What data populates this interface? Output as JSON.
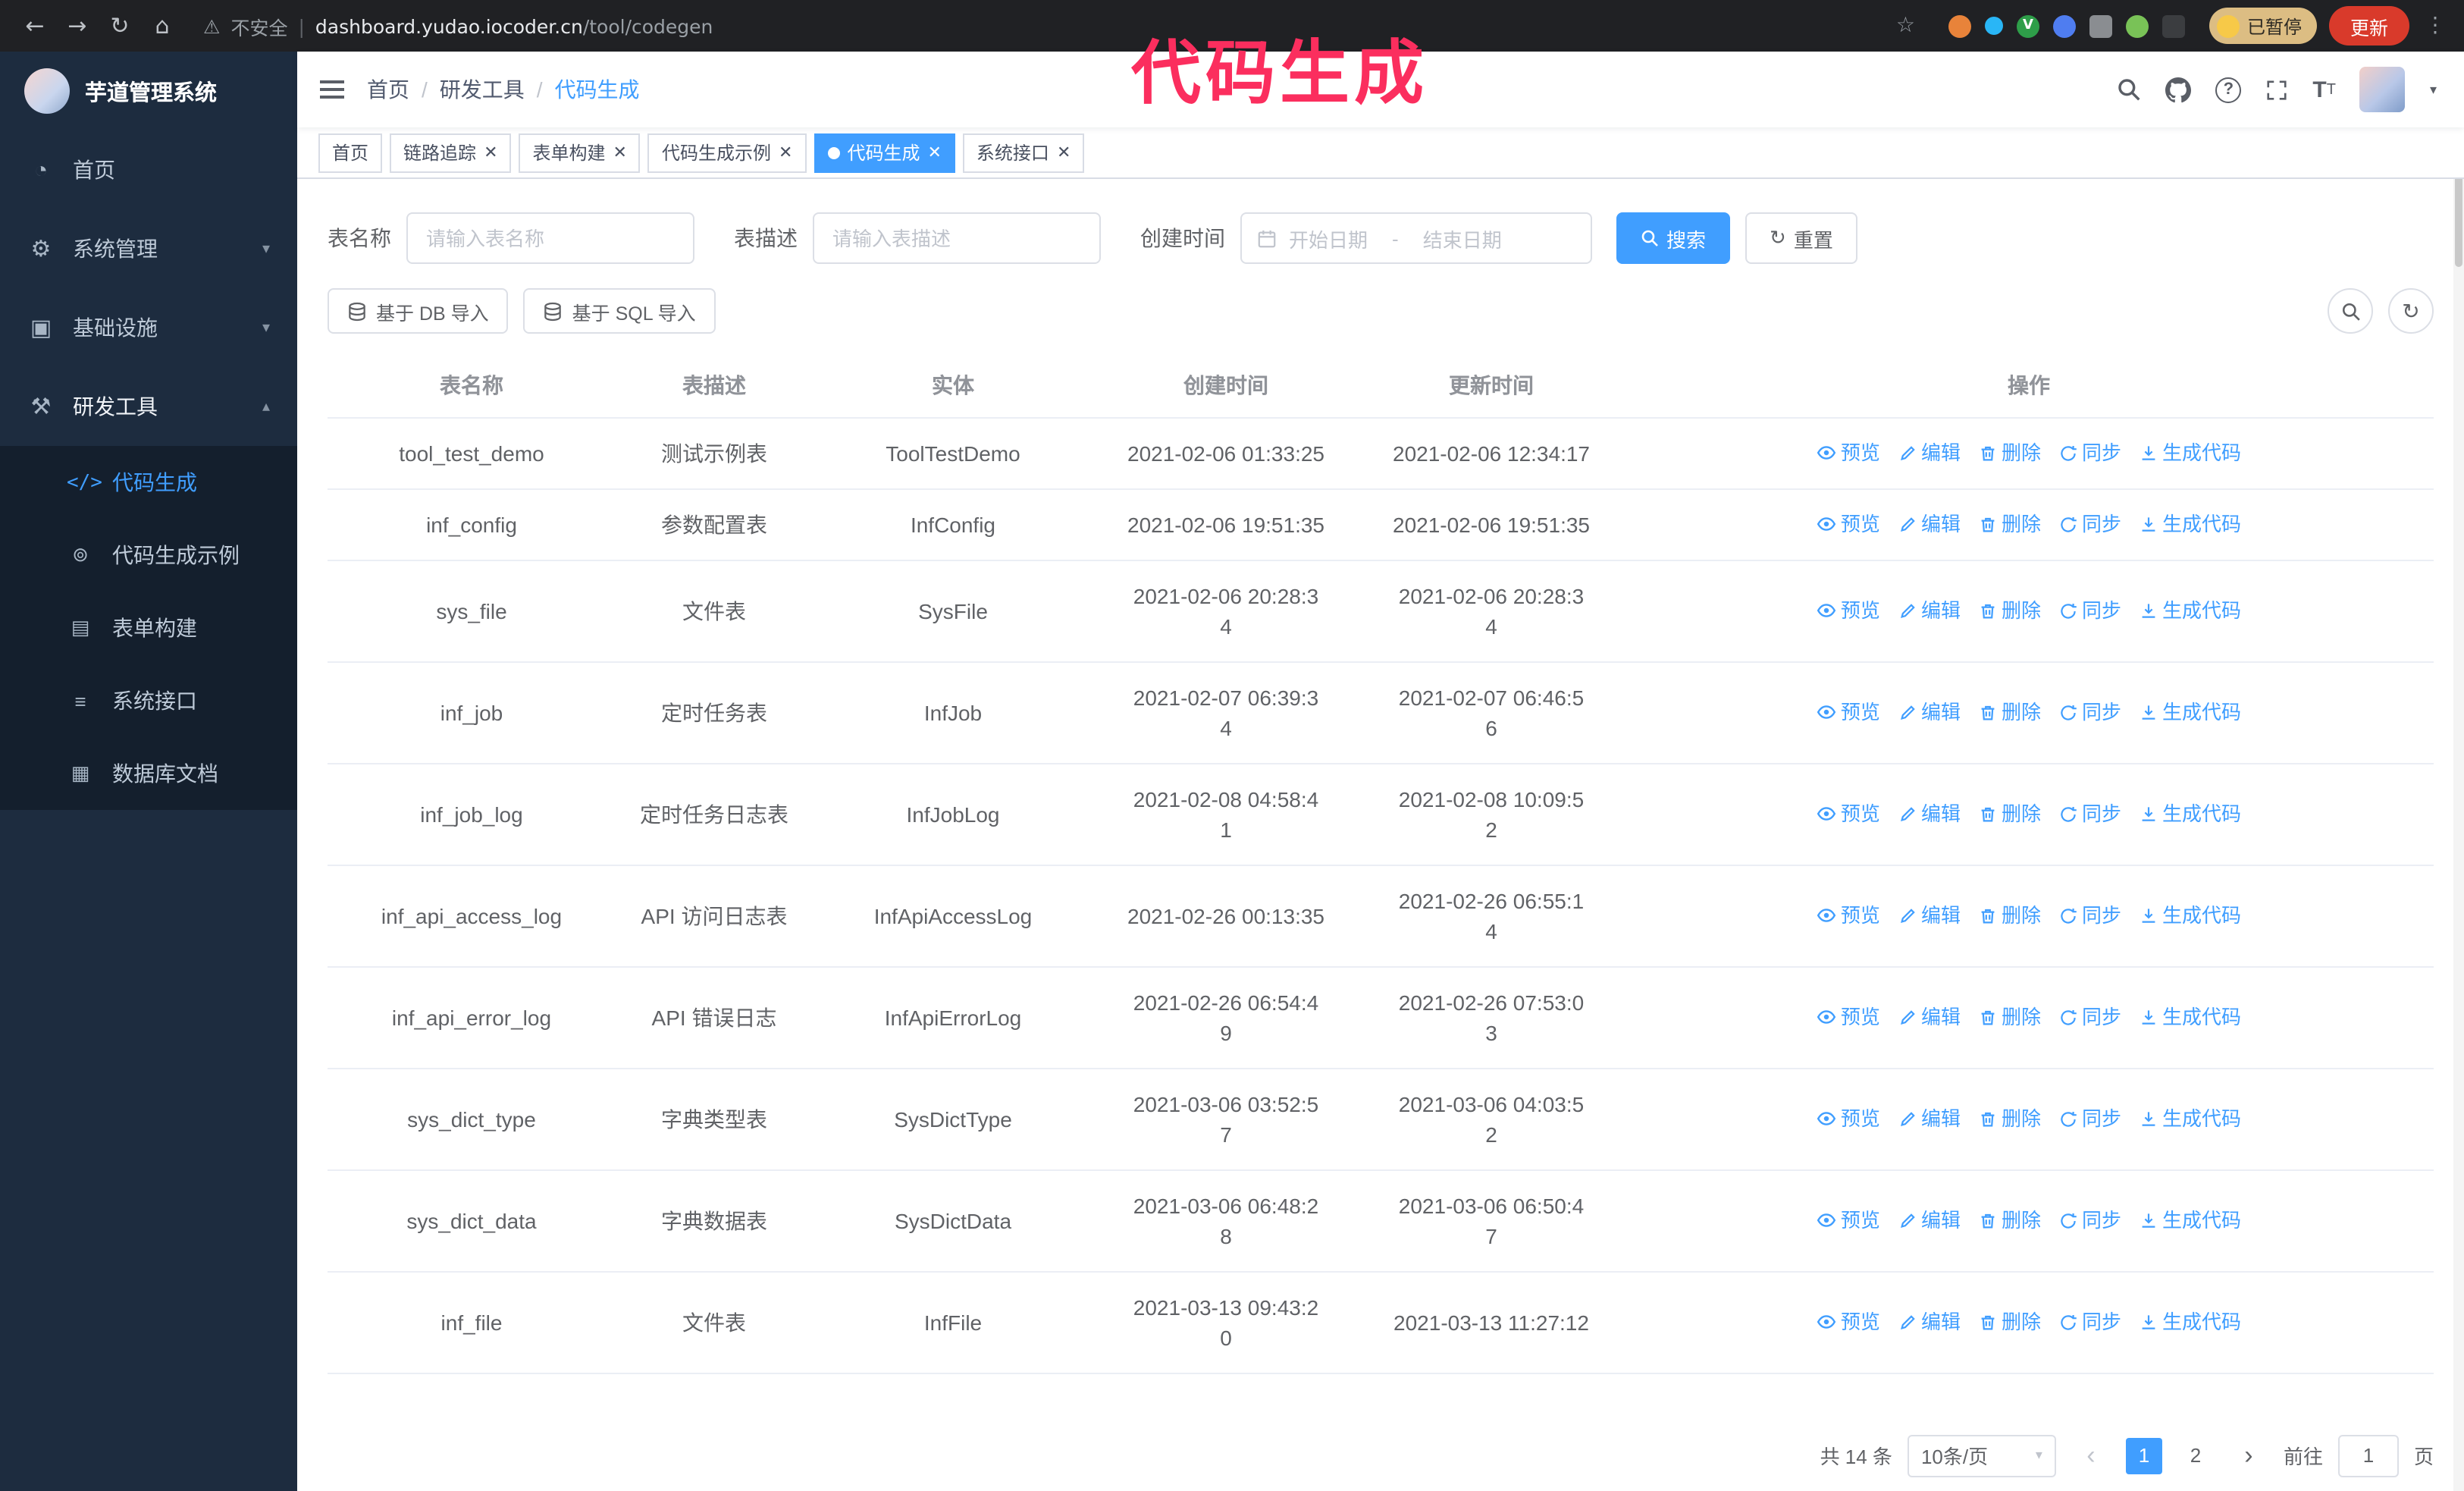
{
  "colors": {
    "accent": "#409eff",
    "sidebar_bg": "#1d2c3f",
    "sidebar_submenu_bg": "#141f2d",
    "chrome_bg": "#202124",
    "annotation": "#fb2e5e",
    "update_button_bg": "#d93a2b"
  },
  "browser": {
    "security_label": "不安全",
    "url_host": "dashboard.yudao.iocoder.cn",
    "url_path": "/tool/codegen",
    "paused_badge": "已暂停",
    "update_button": "更新"
  },
  "annotation": {
    "text": "代码生成"
  },
  "sidebar": {
    "logo_title": "芋道管理系统",
    "menu": [
      {
        "label": "首页",
        "icon": "dashboard-icon"
      },
      {
        "label": "系统管理",
        "icon": "gear-icon"
      },
      {
        "label": "基础设施",
        "icon": "infrastructure-icon"
      },
      {
        "label": "研发工具",
        "icon": "tools-icon"
      }
    ],
    "submenu": [
      {
        "label": "代码生成",
        "icon": "code-icon"
      },
      {
        "label": "代码生成示例",
        "icon": "example-icon"
      },
      {
        "label": "表单构建",
        "icon": "form-icon"
      },
      {
        "label": "系统接口",
        "icon": "api-icon"
      },
      {
        "label": "数据库文档",
        "icon": "database-icon"
      }
    ]
  },
  "navbar": {
    "breadcrumb": [
      "首页",
      "研发工具",
      "代码生成"
    ]
  },
  "tabs": [
    {
      "label": "首页"
    },
    {
      "label": "链路追踪"
    },
    {
      "label": "表单构建"
    },
    {
      "label": "代码生成示例"
    },
    {
      "label": "代码生成"
    },
    {
      "label": "系统接口"
    }
  ],
  "filters": {
    "name_label": "表名称",
    "name_placeholder": "请输入表名称",
    "desc_label": "表描述",
    "desc_placeholder": "请输入表描述",
    "time_label": "创建时间",
    "start_placeholder": "开始日期",
    "range_separator": "-",
    "end_placeholder": "结束日期",
    "search_button": "搜索",
    "reset_button": "重置"
  },
  "toolbar": {
    "import_db_button": "基于 DB 导入",
    "import_sql_button": "基于 SQL 导入"
  },
  "table": {
    "columns": [
      "表名称",
      "表描述",
      "实体",
      "创建时间",
      "更新时间",
      "操作"
    ],
    "actions": [
      {
        "label": "预览",
        "icon": "eye-icon"
      },
      {
        "label": "编辑",
        "icon": "edit-icon"
      },
      {
        "label": "删除",
        "icon": "delete-icon"
      },
      {
        "label": "同步",
        "icon": "sync-icon"
      },
      {
        "label": "生成代码",
        "icon": "download-icon"
      }
    ],
    "rows": [
      {
        "name": "tool_test_demo",
        "desc": "测试示例表",
        "entity": "ToolTestDemo",
        "created": "2021-02-06 01:33:25",
        "updated": "2021-02-06 12:34:17"
      },
      {
        "name": "inf_config",
        "desc": "参数配置表",
        "entity": "InfConfig",
        "created": "2021-02-06 19:51:35",
        "updated": "2021-02-06 19:51:35"
      },
      {
        "name": "sys_file",
        "desc": "文件表",
        "entity": "SysFile",
        "created": "2021-02-06 20:28:3\n4",
        "updated": "2021-02-06 20:28:3\n4"
      },
      {
        "name": "inf_job",
        "desc": "定时任务表",
        "entity": "InfJob",
        "created": "2021-02-07 06:39:3\n4",
        "updated": "2021-02-07 06:46:5\n6"
      },
      {
        "name": "inf_job_log",
        "desc": "定时任务日志表",
        "entity": "InfJobLog",
        "created": "2021-02-08 04:58:4\n1",
        "updated": "2021-02-08 10:09:5\n2"
      },
      {
        "name": "inf_api_access_log",
        "desc": "API 访问日志表",
        "entity": "InfApiAccessLog",
        "created": "2021-02-26 00:13:35",
        "updated": "2021-02-26 06:55:1\n4"
      },
      {
        "name": "inf_api_error_log",
        "desc": "API 错误日志",
        "entity": "InfApiErrorLog",
        "created": "2021-02-26 06:54:4\n9",
        "updated": "2021-02-26 07:53:0\n3"
      },
      {
        "name": "sys_dict_type",
        "desc": "字典类型表",
        "entity": "SysDictType",
        "created": "2021-03-06 03:52:5\n7",
        "updated": "2021-03-06 04:03:5\n2"
      },
      {
        "name": "sys_dict_data",
        "desc": "字典数据表",
        "entity": "SysDictData",
        "created": "2021-03-06 06:48:2\n8",
        "updated": "2021-03-06 06:50:4\n7"
      },
      {
        "name": "inf_file",
        "desc": "文件表",
        "entity": "InfFile",
        "created": "2021-03-13 09:43:2\n0",
        "updated": "2021-03-13 11:27:12"
      }
    ]
  },
  "pagination": {
    "total": "共 14 条",
    "page_size": "10条/页",
    "page_1": "1",
    "page_2": "2",
    "goto_label": "前往",
    "goto_value": "1",
    "goto_unit": "页"
  }
}
